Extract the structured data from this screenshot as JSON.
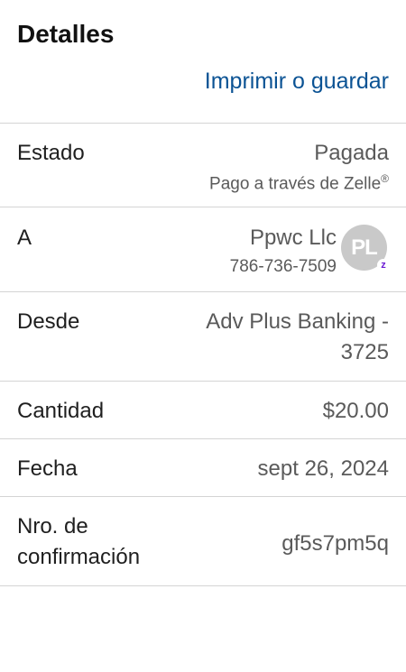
{
  "header": {
    "title": "Detalles",
    "print_link": "Imprimir o guardar"
  },
  "rows": [
    {
      "label": "Estado",
      "value": "Pagada",
      "sub": "Pago a través de Zelle",
      "sub_mark": "®"
    },
    {
      "label": "A",
      "value": "Ppwc Llc",
      "sub": "786-736-7509",
      "avatar_initials": "PL",
      "badge_icon": "zelle-z-icon"
    },
    {
      "label": "Desde",
      "value_line1": "Adv Plus Banking -",
      "value_line2": "3725"
    },
    {
      "label": "Cantidad",
      "value": "$20.00"
    },
    {
      "label": "Fecha",
      "value": "sept 26, 2024"
    },
    {
      "label_line1": "Nro. de",
      "label_line2": "confirmación",
      "value": "gf5s7pm5q"
    }
  ],
  "colors": {
    "link": "#0b5394",
    "zelle": "#6d1ed4",
    "avatar_bg": "#c9c9c9"
  }
}
